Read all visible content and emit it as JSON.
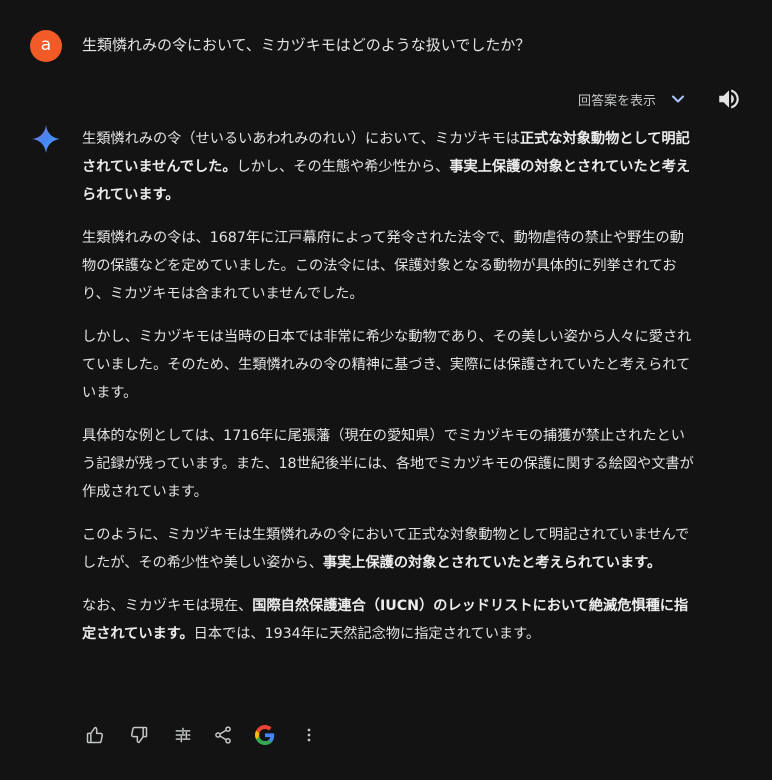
{
  "user": {
    "avatar_letter": "a",
    "avatar_color": "#f25a27"
  },
  "prompt": "生類憐れみの令において、ミカヅキモはどのような扱いでしたか？",
  "toolbar": {
    "drafts_label": "回答案を表示"
  },
  "response": {
    "p1": [
      "生類憐れみの令（せいるいあわれみのれい）において、ミカヅキモは",
      "正式な対象動物として明記されていませんでした。",
      "しかし、その生態や希少性から、",
      "事実上保護の対象とされていたと考えられています。"
    ],
    "p2": "生類憐れみの令は、1687年に江戸幕府によって発令された法令で、動物虐待の禁止や野生の動物の保護などを定めていました。この法令には、保護対象となる動物が具体的に列挙されており、ミカヅキモは含まれていませんでした。",
    "p3": "しかし、ミカヅキモは当時の日本では非常に希少な動物であり、その美しい姿から人々に愛されていました。そのため、生類憐れみの令の精神に基づき、実際には保護されていたと考えられています。",
    "p4": "具体的な例としては、1716年に尾張藩（現在の愛知県）でミカヅキモの捕獲が禁止されたという記録が残っています。また、18世紀後半には、各地でミカヅキモの保護に関する絵図や文書が作成されています。",
    "p5": [
      "このように、ミカヅキモは生類憐れみの令において正式な対象動物として明記されていませんでしたが、その希少性や美しい姿から、",
      "事実上保護の対象とされていたと考えられています。"
    ],
    "p6": [
      "なお、ミカヅキモは現在、",
      "国際自然保護連合（IUCN）のレッドリストにおいて絶滅危惧種に指定されています。",
      "日本では、1934年に天然記念物に指定されています。"
    ]
  },
  "colors": {
    "background": "#131314",
    "text": "#e3e3e3",
    "icon": "#c4c7c5"
  }
}
